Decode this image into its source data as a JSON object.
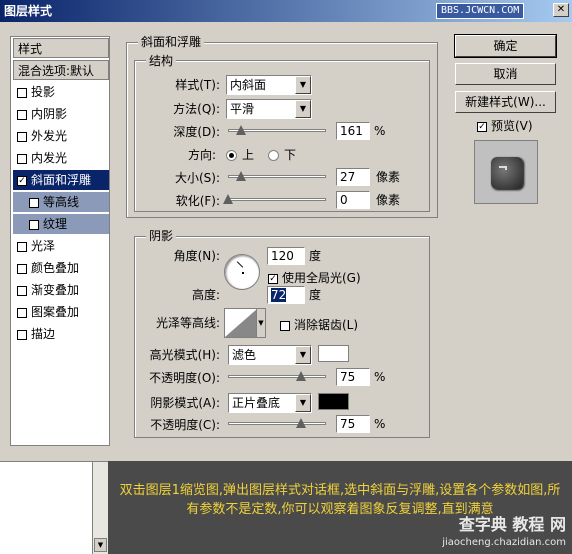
{
  "window": {
    "title": "图层样式",
    "watermark": "BBS.JCWCN.COM",
    "close": "✕"
  },
  "list": {
    "header": "样式",
    "blend": "混合选项:默认",
    "items": [
      "投影",
      "内阴影",
      "外发光",
      "内发光",
      "斜面和浮雕",
      "等高线",
      "纹理",
      "光泽",
      "颜色叠加",
      "渐变叠加",
      "图案叠加",
      "描边"
    ]
  },
  "bevel": {
    "group": "斜面和浮雕",
    "struct": "结构",
    "style_label": "样式(T):",
    "style_value": "内斜面",
    "method_label": "方法(Q):",
    "method_value": "平滑",
    "depth_label": "深度(D):",
    "depth_value": "161",
    "depth_unit": "%",
    "dir_label": "方向:",
    "dir_up": "上",
    "dir_down": "下",
    "size_label": "大小(S):",
    "size_value": "27",
    "size_unit": "像素",
    "soften_label": "软化(F):",
    "soften_value": "0",
    "soften_unit": "像素"
  },
  "shading": {
    "group": "阴影",
    "angle_label": "角度(N):",
    "angle_value": "120",
    "angle_unit": "度",
    "global": "使用全局光(G)",
    "alt_label": "高度:",
    "alt_value": "72",
    "alt_unit": "度",
    "gloss_label": "光泽等高线:",
    "anti": "消除锯齿(L)",
    "hl_label": "高光模式(H):",
    "hl_value": "滤色",
    "hl_op_label": "不透明度(O):",
    "hl_op_value": "75",
    "pct": "%",
    "sh_label": "阴影模式(A):",
    "sh_value": "正片叠底",
    "sh_op_label": "不透明度(C):",
    "sh_op_value": "75",
    "hl_color": "#ffffff",
    "sh_color": "#000000"
  },
  "buttons": {
    "ok": "确定",
    "cancel": "取消",
    "new_style": "新建样式(W)...",
    "preview": "预览(V)"
  },
  "caption": {
    "text": "双击图层1缩览图,弹出图层样式对话框,选中斜面与浮雕,设置各个参数如图,所有参数不是定数,你可以观察着图象反复调整,直到满意"
  },
  "logo": {
    "main": "查字典 教程 网",
    "sub": "jiaocheng.chazidian.com"
  }
}
